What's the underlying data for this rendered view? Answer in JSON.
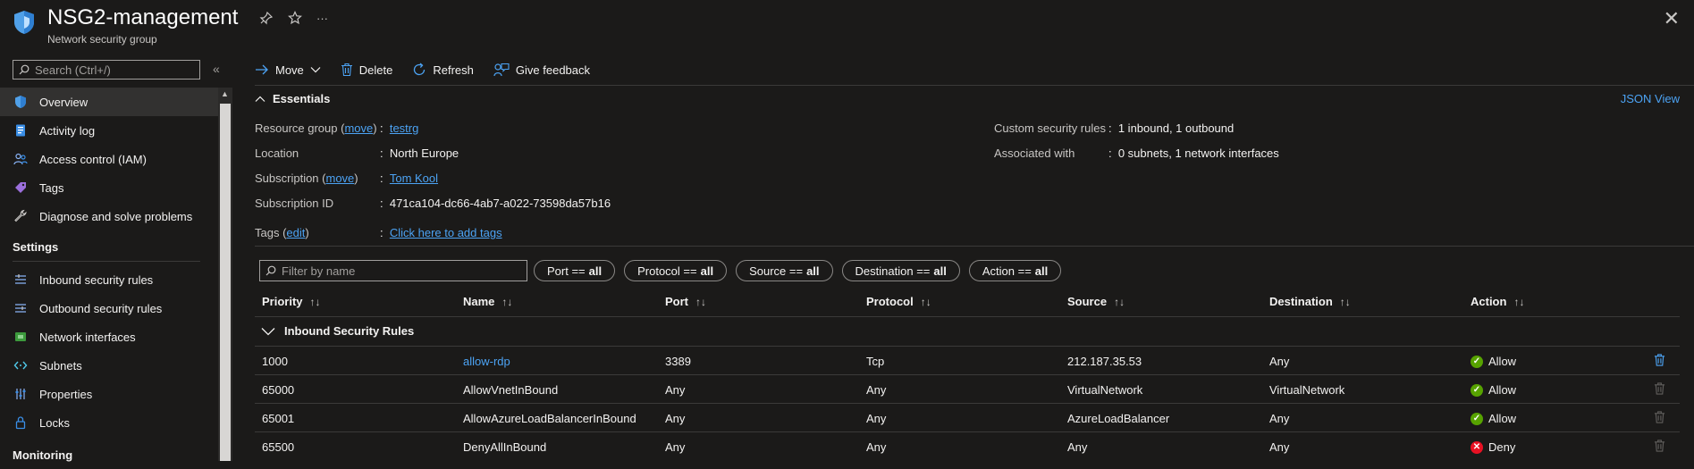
{
  "header": {
    "title": "NSG2-management",
    "subtitle": "Network security group",
    "more": "···",
    "close": "✕"
  },
  "sidebar": {
    "search_placeholder": "Search (Ctrl+/)",
    "collapse": "«",
    "items": [
      {
        "label": "Overview",
        "icon": "shield-icon"
      },
      {
        "label": "Activity log",
        "icon": "activity-log-icon"
      },
      {
        "label": "Access control (IAM)",
        "icon": "people-icon"
      },
      {
        "label": "Tags",
        "icon": "tag-icon"
      },
      {
        "label": "Diagnose and solve problems",
        "icon": "wrench-icon"
      }
    ],
    "settings_heading": "Settings",
    "settings_items": [
      {
        "label": "Inbound security rules",
        "icon": "inbound-rules-icon"
      },
      {
        "label": "Outbound security rules",
        "icon": "outbound-rules-icon"
      },
      {
        "label": "Network interfaces",
        "icon": "network-interface-icon"
      },
      {
        "label": "Subnets",
        "icon": "subnet-icon"
      },
      {
        "label": "Properties",
        "icon": "properties-icon"
      },
      {
        "label": "Locks",
        "icon": "lock-icon"
      }
    ],
    "monitoring_heading": "Monitoring"
  },
  "toolbar": {
    "move": "Move",
    "delete": "Delete",
    "refresh": "Refresh",
    "feedback": "Give feedback"
  },
  "essentials": {
    "heading": "Essentials",
    "json_view": "JSON View",
    "left": [
      {
        "label": "Resource group",
        "edit": "move",
        "value": "testrg",
        "link": true
      },
      {
        "label": "Location",
        "value": "North Europe",
        "link": false
      },
      {
        "label": "Subscription",
        "edit": "move",
        "value": "Tom Kool",
        "link": true
      },
      {
        "label": "Subscription ID",
        "value": "471ca104-dc66-4ab7-a022-73598da57b16",
        "link": false
      },
      {
        "label": "Tags",
        "edit": "edit",
        "value": "Click here to add tags",
        "link": true
      }
    ],
    "right": [
      {
        "label": "Custom security rules",
        "value": "1 inbound, 1 outbound"
      },
      {
        "label": "Associated with",
        "value": "0 subnets, 1 network interfaces"
      }
    ]
  },
  "filters": {
    "placeholder": "Filter by name",
    "pills": [
      {
        "key": "Port == ",
        "value": "all"
      },
      {
        "key": "Protocol == ",
        "value": "all"
      },
      {
        "key": "Source == ",
        "value": "all"
      },
      {
        "key": "Destination == ",
        "value": "all"
      },
      {
        "key": "Action == ",
        "value": "all"
      }
    ]
  },
  "table": {
    "columns": [
      "Priority",
      "Name",
      "Port",
      "Protocol",
      "Source",
      "Destination",
      "Action"
    ],
    "group": "Inbound Security Rules",
    "rows": [
      {
        "priority": "1000",
        "name": "allow-rdp",
        "name_link": true,
        "port": "3389",
        "protocol": "Tcp",
        "source": "212.187.35.53",
        "destination": "Any",
        "action": "Allow",
        "deletable": true
      },
      {
        "priority": "65000",
        "name": "AllowVnetInBound",
        "name_link": false,
        "port": "Any",
        "protocol": "Any",
        "source": "VirtualNetwork",
        "destination": "VirtualNetwork",
        "action": "Allow",
        "deletable": false
      },
      {
        "priority": "65001",
        "name": "AllowAzureLoadBalancerInBound",
        "name_link": false,
        "port": "Any",
        "protocol": "Any",
        "source": "AzureLoadBalancer",
        "destination": "Any",
        "action": "Allow",
        "deletable": false
      },
      {
        "priority": "65500",
        "name": "DenyAllInBound",
        "name_link": false,
        "port": "Any",
        "protocol": "Any",
        "source": "Any",
        "destination": "Any",
        "action": "Deny",
        "deletable": false
      }
    ]
  },
  "colors": {
    "accent": "#4ca3f4",
    "allow": "#57a300",
    "deny": "#e81123",
    "background": "#1b1a19"
  }
}
